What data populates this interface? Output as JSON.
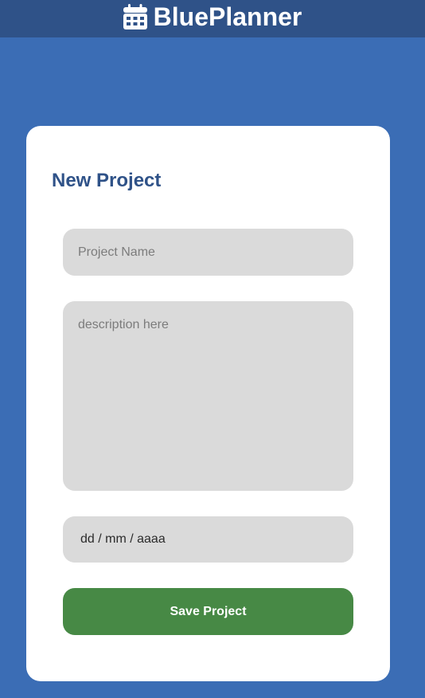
{
  "app": {
    "title": "BluePlanner",
    "icon": "calendar-icon"
  },
  "form": {
    "heading": "New Project",
    "project_name": {
      "value": "",
      "placeholder": "Project Name"
    },
    "description": {
      "value": "",
      "placeholder": "description here"
    },
    "date": {
      "placeholder": "dd / mm / aaaa"
    },
    "save_label": "Save Project"
  },
  "colors": {
    "background": "#3b6db5",
    "header": "#2f5288",
    "card": "#ffffff",
    "heading": "#2f5288",
    "field": "#dadada",
    "save_button": "#478945"
  }
}
